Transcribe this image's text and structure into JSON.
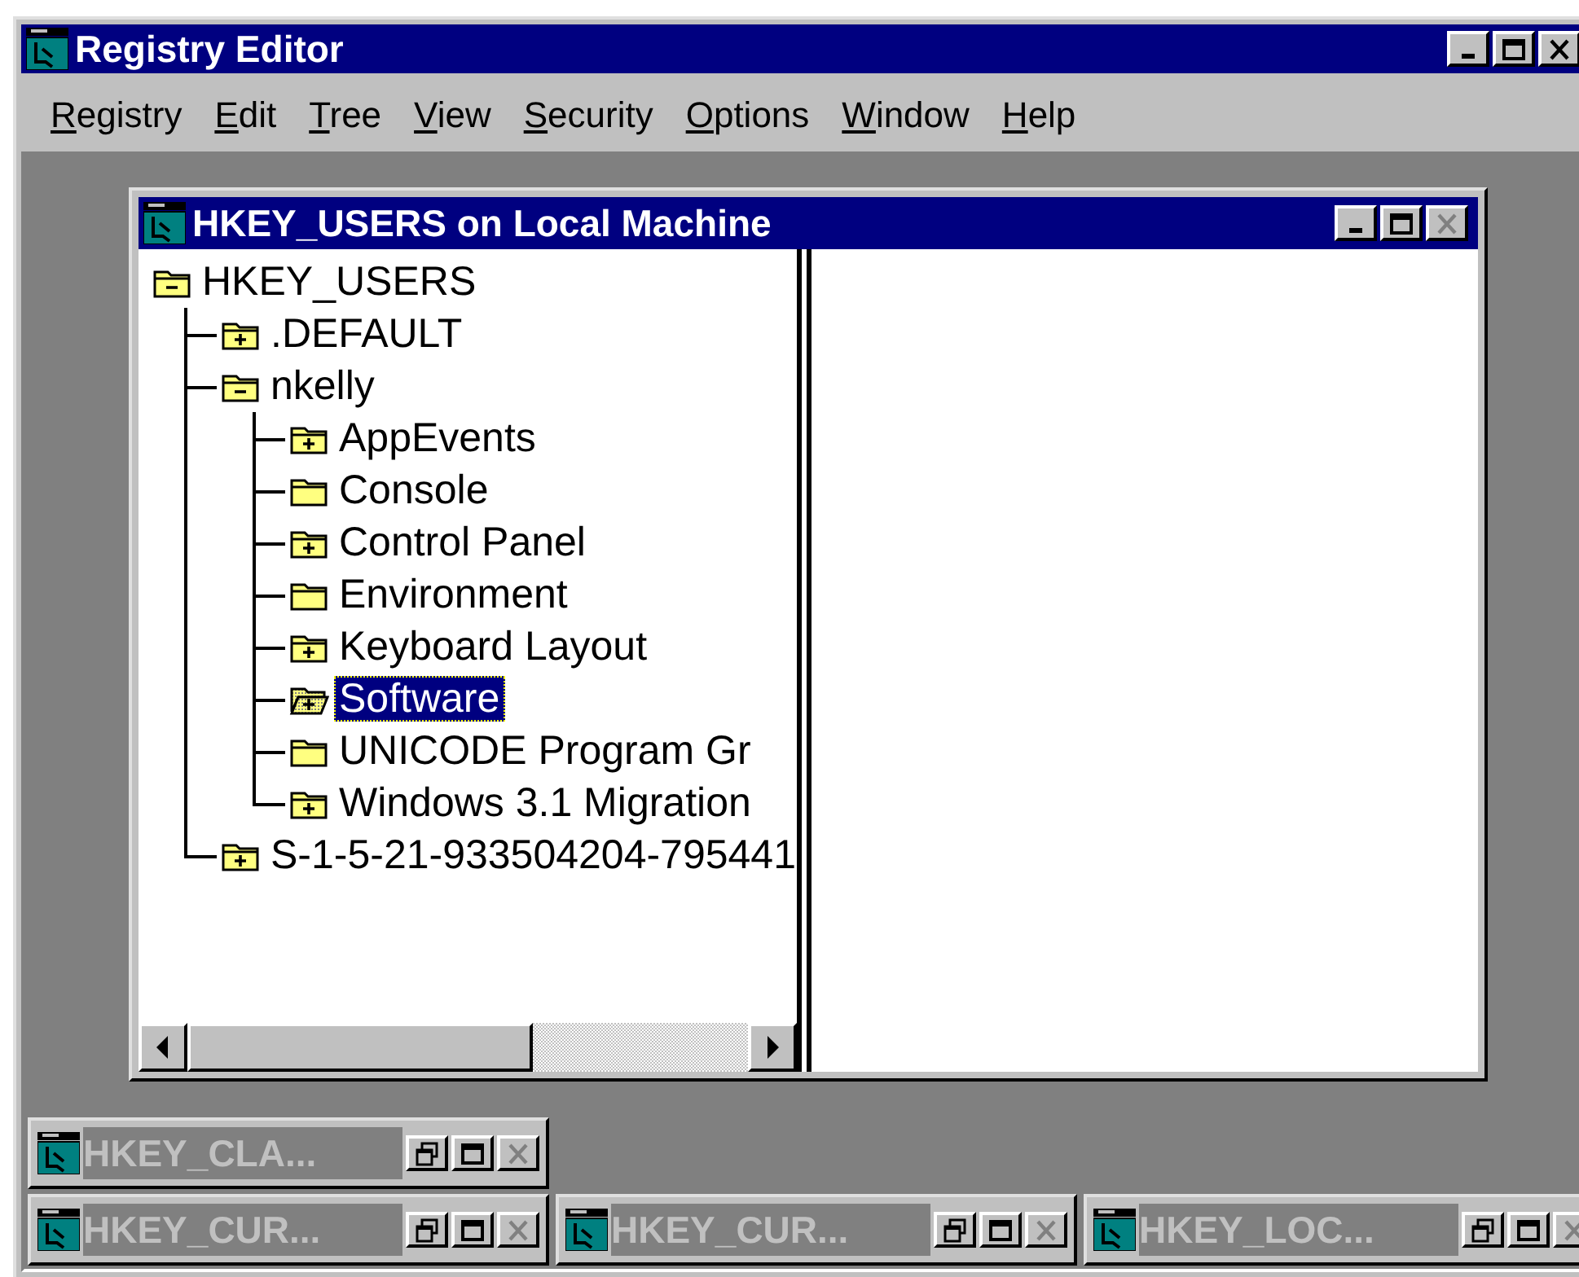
{
  "app": {
    "title": "Registry Editor",
    "menu": [
      "Registry",
      "Edit",
      "Tree",
      "View",
      "Security",
      "Options",
      "Window",
      "Help"
    ]
  },
  "child_window": {
    "title": "HKEY_USERS on Local Machine",
    "tree": [
      {
        "label": "HKEY_USERS",
        "kind": "expanded",
        "selected": false,
        "children": [
          {
            "label": ".DEFAULT",
            "kind": "collapsed",
            "selected": false
          },
          {
            "label": "nkelly",
            "kind": "expanded",
            "selected": false,
            "children": [
              {
                "label": "AppEvents",
                "kind": "collapsed",
                "selected": false
              },
              {
                "label": "Console",
                "kind": "leaf",
                "selected": false
              },
              {
                "label": "Control Panel",
                "kind": "collapsed",
                "selected": false
              },
              {
                "label": "Environment",
                "kind": "leaf",
                "selected": false
              },
              {
                "label": "Keyboard Layout",
                "kind": "collapsed",
                "selected": false
              },
              {
                "label": "Software",
                "kind": "collapsed",
                "selected": true
              },
              {
                "label": "UNICODE Program Gr",
                "kind": "leaf",
                "selected": false
              },
              {
                "label": "Windows 3.1 Migration",
                "kind": "collapsed",
                "selected": false
              }
            ]
          },
          {
            "label": "S-1-5-21-933504204-795441",
            "kind": "collapsed",
            "selected": false
          }
        ]
      }
    ]
  },
  "minimized_windows": [
    {
      "title": "HKEY_CLA..."
    },
    {
      "title": "HKEY_CUR..."
    },
    {
      "title": "HKEY_CUR..."
    },
    {
      "title": "HKEY_LOC..."
    }
  ]
}
